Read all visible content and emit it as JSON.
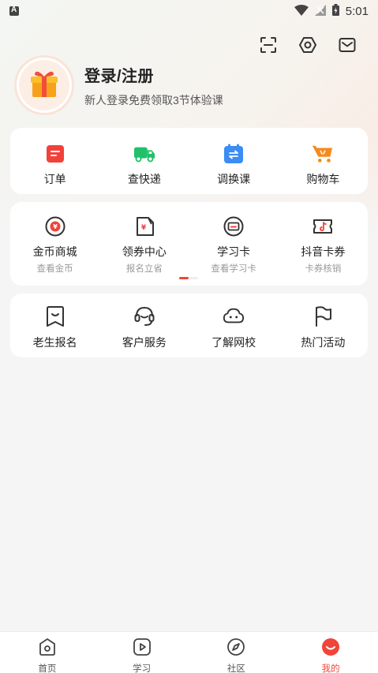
{
  "status_bar": {
    "time": "5:01"
  },
  "top_icons": [
    "scan-icon",
    "settings-icon",
    "message-icon"
  ],
  "profile": {
    "title": "登录/注册",
    "subtitle": "新人登录免费领取3节体验课"
  },
  "card1": {
    "items": [
      {
        "label": "订单",
        "icon": "order-icon",
        "color": "#f2413b"
      },
      {
        "label": "查快递",
        "icon": "delivery-truck-icon",
        "color": "#22c06b"
      },
      {
        "label": "调换课",
        "icon": "calendar-swap-icon",
        "color": "#3b8cf5"
      },
      {
        "label": "购物车",
        "icon": "cart-icon",
        "color": "#f58a1f"
      }
    ]
  },
  "card2": {
    "items": [
      {
        "label": "金币商城",
        "sub": "查看金币",
        "icon": "coin-icon"
      },
      {
        "label": "领券中心",
        "sub": "报名立省",
        "icon": "coupon-center-icon"
      },
      {
        "label": "学习卡",
        "sub": "查看学习卡",
        "icon": "study-card-icon"
      },
      {
        "label": "抖音卡券",
        "sub": "卡券核销",
        "icon": "douyin-ticket-icon"
      }
    ]
  },
  "card3": {
    "items": [
      {
        "label": "老生报名",
        "icon": "bookmark-smile-icon"
      },
      {
        "label": "客户服务",
        "icon": "customer-service-icon"
      },
      {
        "label": "了解网校",
        "icon": "cloud-face-icon"
      },
      {
        "label": "热门活动",
        "icon": "flag-icon"
      }
    ]
  },
  "bottom_nav": {
    "items": [
      {
        "label": "首页",
        "icon": "home-icon"
      },
      {
        "label": "学习",
        "icon": "play-icon"
      },
      {
        "label": "社区",
        "icon": "compass-icon"
      },
      {
        "label": "我的",
        "icon": "me-icon",
        "active": true
      }
    ]
  },
  "colors": {
    "accent": "#f0453a"
  }
}
